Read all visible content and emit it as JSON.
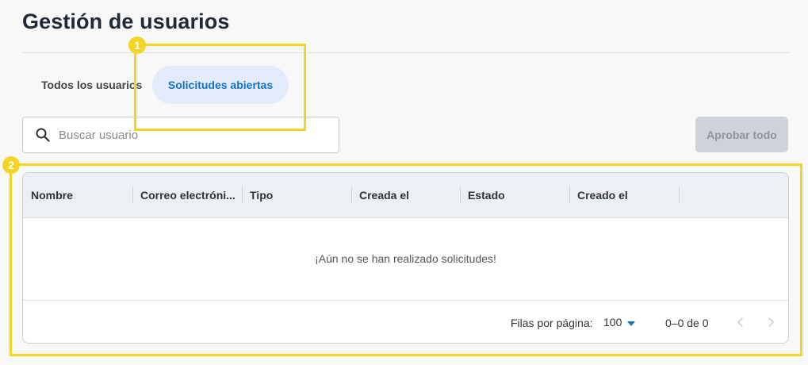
{
  "page": {
    "title": "Gestión de usuarios"
  },
  "tabs": [
    {
      "label": "Todos los usuarios",
      "selected": false
    },
    {
      "label": "Solicitudes abiertas",
      "selected": true
    }
  ],
  "search": {
    "placeholder": "Buscar usuario",
    "value": ""
  },
  "actions": {
    "approve_all": "Aprobar todo",
    "approve_all_enabled": false
  },
  "table": {
    "columns": [
      "Nombre",
      "Correo electróni...",
      "Tipo",
      "Creada el",
      "Estado",
      "Creado el"
    ],
    "rows": [],
    "empty_message": "¡Aún no se han realizado solicitudes!"
  },
  "pagination": {
    "rows_per_page_label": "Filas por página:",
    "rows_per_page": "100",
    "range": "0–0 de 0"
  },
  "callouts": [
    {
      "number": "1"
    },
    {
      "number": "2"
    }
  ],
  "colors": {
    "accent": "#1473c6",
    "selected_tab_bg": "#e3ebfa",
    "callout": "#f3d524",
    "disabled_button_bg": "#cfd3d9"
  },
  "icons": [
    "search-icon",
    "chevron-left-icon",
    "chevron-right-icon",
    "caret-down-icon"
  ]
}
